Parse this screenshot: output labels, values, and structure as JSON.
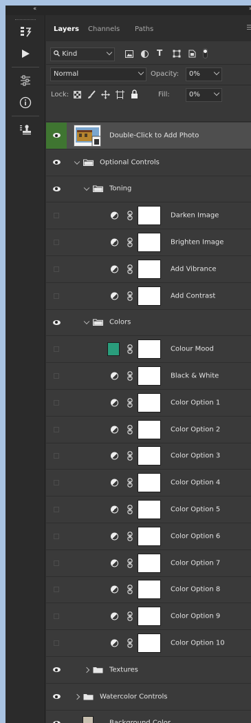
{
  "panel": {
    "tabs": [
      {
        "label": "Layers",
        "active": true
      },
      {
        "label": "Channels",
        "active": false
      },
      {
        "label": "Paths",
        "active": false
      }
    ]
  },
  "filter": {
    "kind_label": "Kind"
  },
  "blend": {
    "mode": "Normal",
    "opacity_label": "Opacity:",
    "opacity_value": "0%"
  },
  "lock": {
    "label": "Lock:",
    "fill_label": "Fill:",
    "fill_value": "0%"
  },
  "colors": {
    "accent_visible_cell": "#3f7531",
    "colour_mood_swatch": "#2a9d7c",
    "background_swatch": "#c8bfaf"
  },
  "layers": [
    {
      "name": "Double-Click to Add Photo",
      "type": "smart-photo",
      "visible": true,
      "selected": true,
      "indent": 0
    },
    {
      "name": "Optional Controls",
      "type": "group-open",
      "visible": true,
      "indent": 0
    },
    {
      "name": "Toning",
      "type": "group-open",
      "visible": true,
      "indent": 1
    },
    {
      "name": "Darken Image",
      "type": "adjustment",
      "visible": false,
      "indent": 2
    },
    {
      "name": "Brighten Image",
      "type": "adjustment",
      "visible": false,
      "indent": 2
    },
    {
      "name": "Add Vibrance",
      "type": "adjustment",
      "visible": false,
      "indent": 2
    },
    {
      "name": "Add Contrast",
      "type": "adjustment",
      "visible": false,
      "indent": 2
    },
    {
      "name": "Colors",
      "type": "group-open",
      "visible": true,
      "indent": 1
    },
    {
      "name": "Colour Mood",
      "type": "fill",
      "visible": false,
      "indent": 2
    },
    {
      "name": "Black & White",
      "type": "adjustment",
      "visible": false,
      "indent": 2
    },
    {
      "name": "Color Option 1",
      "type": "adjustment",
      "visible": false,
      "indent": 2
    },
    {
      "name": "Color Option 2",
      "type": "adjustment",
      "visible": false,
      "indent": 2
    },
    {
      "name": "Color Option 3",
      "type": "adjustment",
      "visible": false,
      "indent": 2
    },
    {
      "name": "Color Option 4",
      "type": "adjustment",
      "visible": false,
      "indent": 2
    },
    {
      "name": "Color Option 5",
      "type": "adjustment",
      "visible": false,
      "indent": 2
    },
    {
      "name": "Color Option 6",
      "type": "adjustment",
      "visible": false,
      "indent": 2
    },
    {
      "name": "Color Option 7",
      "type": "adjustment",
      "visible": false,
      "indent": 2
    },
    {
      "name": "Color Option 8",
      "type": "adjustment",
      "visible": false,
      "indent": 2
    },
    {
      "name": "Color Option 9",
      "type": "adjustment",
      "visible": false,
      "indent": 2
    },
    {
      "name": "Color Option 10",
      "type": "adjustment",
      "visible": false,
      "indent": 2
    },
    {
      "name": "Textures",
      "type": "group-closed",
      "visible": true,
      "indent": 1
    },
    {
      "name": "Watercolor Controls",
      "type": "group-closed",
      "visible": true,
      "indent": 0
    },
    {
      "name": "Background Color",
      "type": "solid",
      "visible": true,
      "indent": 0
    }
  ]
}
